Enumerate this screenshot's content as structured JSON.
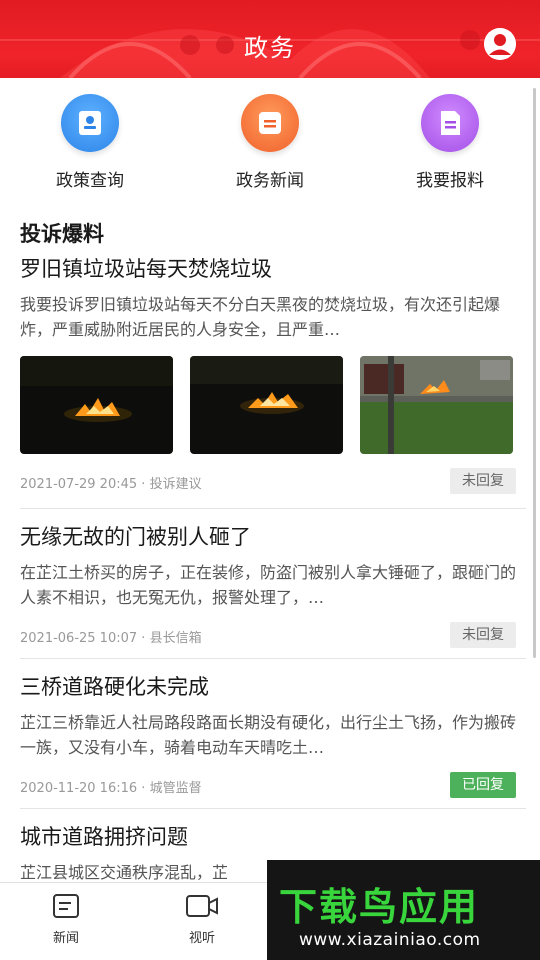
{
  "header": {
    "title": "政务"
  },
  "quick_links": [
    {
      "label": "政策查询",
      "icon": "policy-icon",
      "color": "#2c84e8"
    },
    {
      "label": "政务新闻",
      "icon": "news-icon",
      "color": "#f0612b"
    },
    {
      "label": "我要报料",
      "icon": "report-icon",
      "color": "#a34fe6"
    }
  ],
  "section_title": "投诉爆料",
  "posts": [
    {
      "title": "罗旧镇垃圾站每天焚烧垃圾",
      "body": "我要投诉罗旧镇垃圾站每天不分白天黑夜的焚烧垃圾，有次还引起爆炸，严重威胁附近居民的人身安全，且严重…",
      "date": "2021-07-29 20:45",
      "category": "投诉建议",
      "status": "未回复"
    },
    {
      "title": "无缘无故的门被别人砸了",
      "body": "在芷江土桥买的房子，正在装修，防盗门被别人拿大锤砸了，跟砸门的人素不相识，也无冤无仇，报警处理了，…",
      "date": "2021-06-25 10:07",
      "category": "县长信箱",
      "status": "未回复"
    },
    {
      "title": "三桥道路硬化未完成",
      "body": "芷江三桥靠近人社局路段路面长期没有硬化，出行尘土飞扬，作为搬砖一族，又没有小车，骑着电动车天晴吃土…",
      "date": "2020-11-20 16:16",
      "category": "城管监督",
      "status": "已回复"
    },
    {
      "title": "城市道路拥挤问题",
      "body": "芷江县城区交通秩序混乱，芷"
    }
  ],
  "bottom_nav": [
    {
      "label": "新闻",
      "icon": "news-tab-icon"
    },
    {
      "label": "视听",
      "icon": "video-tab-icon"
    }
  ],
  "watermark": {
    "logo": "下载鸟应用",
    "url": "www.xiazainiao.com"
  },
  "colors": {
    "header_red": "#e11b22",
    "replied_green": "#4cb15a"
  }
}
